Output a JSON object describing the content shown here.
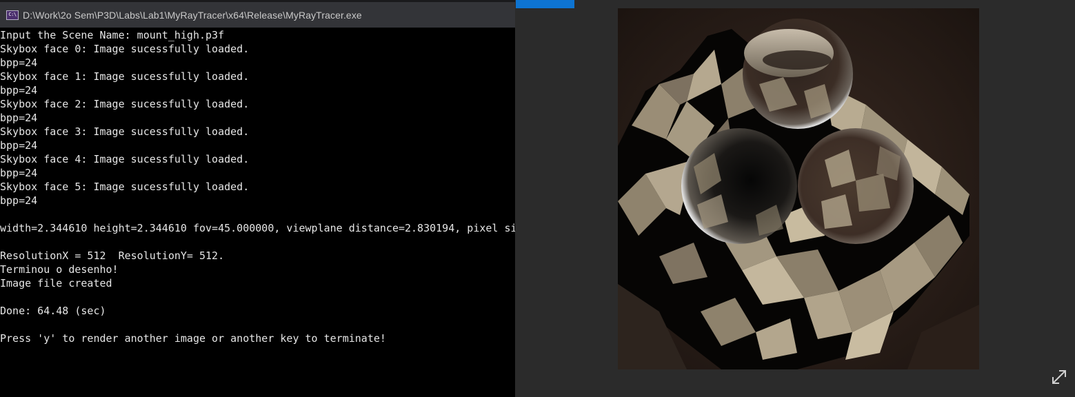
{
  "window": {
    "title": "D:\\Work\\2o Sem\\P3D\\Labs\\Lab1\\MyRayTracer\\x64\\Release\\MyRayTracer.exe",
    "icon": "console-app-icon",
    "icon_glyph": "C:\\"
  },
  "console": {
    "lines": [
      "Input the Scene Name: mount_high.p3f",
      "Skybox face 0: Image sucessfully loaded.",
      "bpp=24",
      "Skybox face 1: Image sucessfully loaded.",
      "bpp=24",
      "Skybox face 2: Image sucessfully loaded.",
      "bpp=24",
      "Skybox face 3: Image sucessfully loaded.",
      "bpp=24",
      "Skybox face 4: Image sucessfully loaded.",
      "bpp=24",
      "Skybox face 5: Image sucessfully loaded.",
      "bpp=24",
      "",
      "width=2.344610 height=2.344610 fov=45.000000, viewplane distance=2.830194, pixel si",
      "",
      "ResolutionX = 512  ResolutionY= 512.",
      "Terminou o desenho!",
      "Image file created",
      "",
      "Done: 64.48 (sec)",
      "",
      "Press 'y' to render another image or another key to terminate!"
    ]
  },
  "viewer": {
    "image": "ray-traced-render",
    "expand_icon": "expand-icon",
    "colors": {
      "background": "#2b2b2b",
      "accent_tab": "#0e74d1",
      "console_bg": "#000000",
      "console_text": "#e6e6e6",
      "titlebar": "#333438"
    }
  }
}
